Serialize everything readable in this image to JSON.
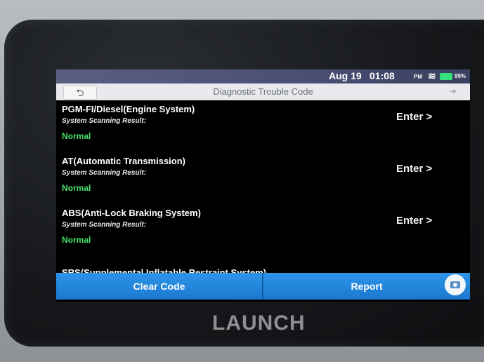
{
  "status": {
    "date": "Aug 19",
    "time": "01:08",
    "ampm": "PM",
    "battery": "99%"
  },
  "titlebar": {
    "title": "Diagnostic Trouble Code",
    "back_icon": "⮌",
    "exit_icon": "⇥"
  },
  "systems": [
    {
      "name": "PGM-FI/Diesel(Engine System)",
      "subtitle": "System Scanning Result:",
      "status": "Normal",
      "action": "Enter >"
    },
    {
      "name": "AT(Automatic Transmission)",
      "subtitle": "System Scanning Result:",
      "status": "Normal",
      "action": "Enter >"
    },
    {
      "name": "ABS(Anti-Lock Braking System)",
      "subtitle": "System Scanning Result:",
      "status": "Normal",
      "action": "Enter >"
    },
    {
      "name": "SRS(Supplemental Inflatable Restraint System)"
    }
  ],
  "buttons": {
    "clear": "Clear Code",
    "report": "Report"
  },
  "brand": "LAUNCH"
}
